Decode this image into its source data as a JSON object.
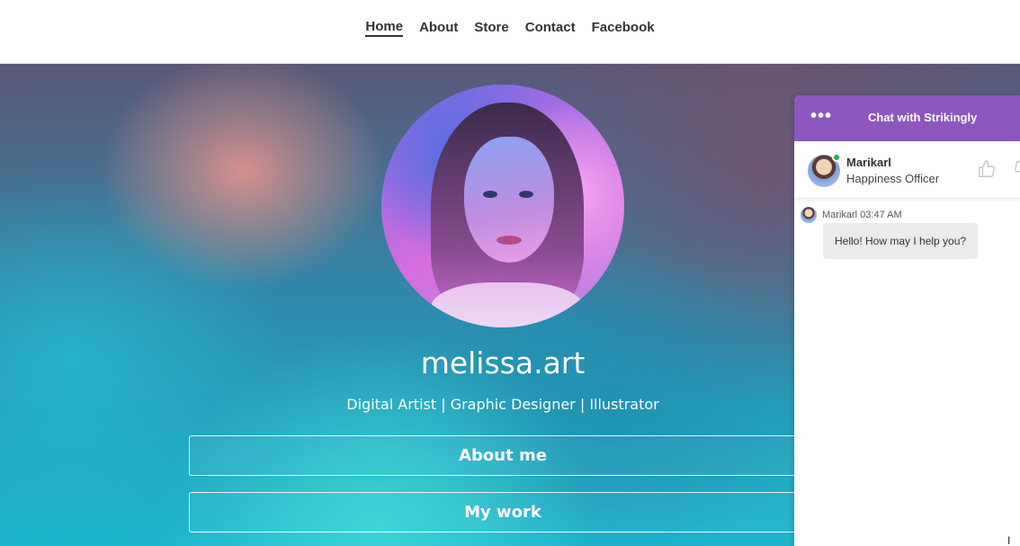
{
  "nav": {
    "items": [
      {
        "label": "Home",
        "active": true
      },
      {
        "label": "About",
        "active": false
      },
      {
        "label": "Store",
        "active": false
      },
      {
        "label": "Contact",
        "active": false
      },
      {
        "label": "Facebook",
        "active": false
      }
    ]
  },
  "hero": {
    "title": "melissa.art",
    "subtitle": "Digital Artist | Graphic Designer | Illustrator",
    "buttons": [
      "About me",
      "My work"
    ]
  },
  "chat": {
    "menu_icon": "more-horizontal-icon",
    "header_title": "Chat with Strikingly",
    "agent": {
      "name": "Marikarl",
      "role": "Happiness Officer",
      "status_color": "#2fa84f"
    },
    "feedback_icons": [
      "thumbs-up-icon",
      "thumbs-down-icon"
    ],
    "messages": [
      {
        "sender": "Marikarl",
        "time": "03:47 AM",
        "meta": "Marikarl 03:47 AM",
        "text": "Hello! How may I help you?"
      }
    ],
    "accent_color": "#8d56bf"
  }
}
